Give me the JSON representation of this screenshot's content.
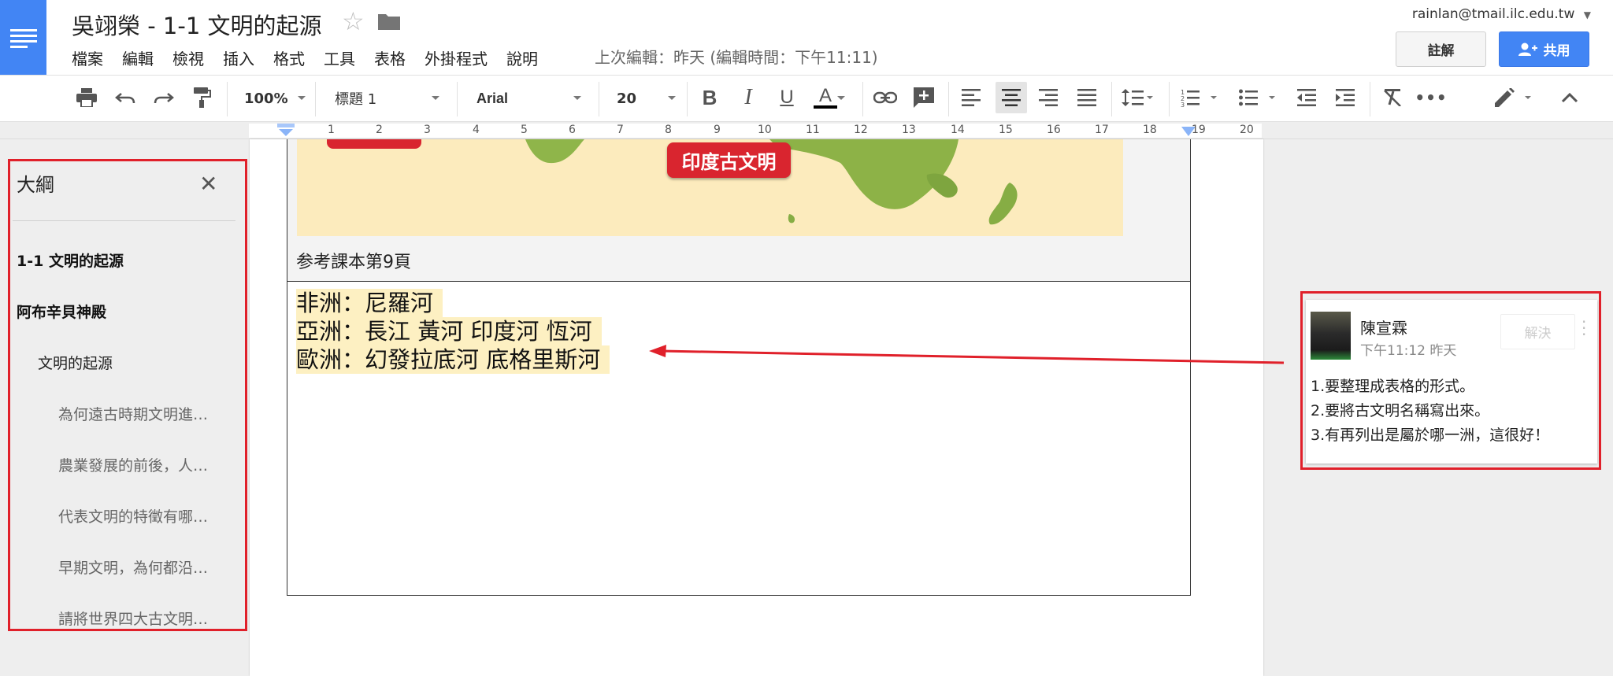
{
  "header": {
    "title": "吳翊榮 - 1-1 文明的起源",
    "account": "rainlan@tmail.ilc.edu.tw",
    "last_edit": "上次編輯：昨天 (編輯時間：下午11:11)",
    "comments_label": "註解",
    "share_label": "共用",
    "accent_color": "#4285f4"
  },
  "menu": [
    "檔案",
    "編輯",
    "檢視",
    "插入",
    "格式",
    "工具",
    "表格",
    "外掛程式",
    "說明"
  ],
  "toolbar": {
    "zoom": "100%",
    "style": "標題 1",
    "font": "Arial",
    "font_size": "20"
  },
  "ruler": [
    "1",
    "2",
    "3",
    "4",
    "5",
    "6",
    "7",
    "8",
    "9",
    "10",
    "11",
    "12",
    "13",
    "14",
    "15",
    "16",
    "17",
    "18",
    "19",
    "20"
  ],
  "document": {
    "map_label": "印度古文明",
    "caption": "参考課本第9頁",
    "rivers": [
      "非洲：尼羅河",
      "亞洲：長江 黃河 印度河 恆河",
      "歐洲：幻發拉底河 底格里斯河"
    ]
  },
  "outline": {
    "title": "大綱",
    "items": [
      {
        "text": "1-1 文明的起源",
        "level": 1
      },
      {
        "text": "阿布辛貝神殿",
        "level": 1
      },
      {
        "text": "文明的起源",
        "level": 2
      },
      {
        "text": "為何遠古時期文明進…",
        "level": 3
      },
      {
        "text": "農業發展的前後，人…",
        "level": 3
      },
      {
        "text": "代表文明的特徵有哪…",
        "level": 3
      },
      {
        "text": "早期文明，為何都沿…",
        "level": 3
      },
      {
        "text": "請將世界四大古文明…",
        "level": 3
      }
    ]
  },
  "comment": {
    "author": "陳宣霖",
    "time": "下午11:12 昨天",
    "resolve_label": "解決",
    "lines": [
      "1.要整理成表格的形式。",
      "2.要將古文明名稱寫出來。",
      "3.有再列出是屬於哪一洲，這很好！"
    ]
  },
  "colors": {
    "highlight": "#fdf0c2",
    "annotation_red": "#e0202a"
  }
}
